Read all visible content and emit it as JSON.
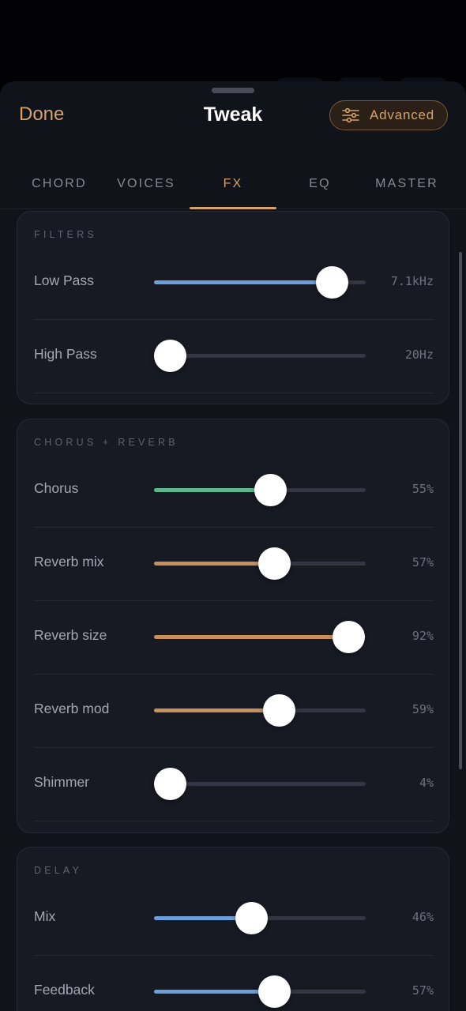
{
  "header": {
    "done_label": "Done",
    "title": "Tweak",
    "advanced_label": "Advanced",
    "advanced_icon": "sliders-icon"
  },
  "tabs": [
    {
      "label": "CHORD",
      "active": false
    },
    {
      "label": "VOICES",
      "active": false
    },
    {
      "label": "FX",
      "active": true
    },
    {
      "label": "EQ",
      "active": false
    },
    {
      "label": "MASTER",
      "active": false
    }
  ],
  "colors": {
    "accent": "#d6a266",
    "filter": "#6a9fdc",
    "chorus": "#5cb88a",
    "reverb": "#c98f59",
    "delay": "#6a9fdc"
  },
  "sections": [
    {
      "title": "FILTERS",
      "controls": [
        {
          "name": "Low Pass",
          "value": "7.1kHz",
          "level": 0.84,
          "color": "#6a9fdc"
        },
        {
          "name": "High Pass",
          "value": "20Hz",
          "level": 0.0,
          "color": "#6a9fdc"
        }
      ]
    },
    {
      "title": "CHORUS + REVERB",
      "controls": [
        {
          "name": "Chorus",
          "value": "55%",
          "level": 0.55,
          "color": "#5cb88a"
        },
        {
          "name": "Reverb mix",
          "value": "57%",
          "level": 0.57,
          "color": "#c98f59"
        },
        {
          "name": "Reverb size",
          "value": "92%",
          "level": 0.92,
          "color": "#c98f59"
        },
        {
          "name": "Reverb mod",
          "value": "59%",
          "level": 0.59,
          "color": "#c98f59"
        },
        {
          "name": "Shimmer",
          "value": "4%",
          "level": 0.04,
          "color": "#c98f59"
        }
      ]
    },
    {
      "title": "DELAY",
      "controls": [
        {
          "name": "Mix",
          "value": "46%",
          "level": 0.46,
          "color": "#6a9fdc"
        },
        {
          "name": "Feedback",
          "value": "57%",
          "level": 0.57,
          "color": "#6a9fdc"
        }
      ]
    }
  ]
}
